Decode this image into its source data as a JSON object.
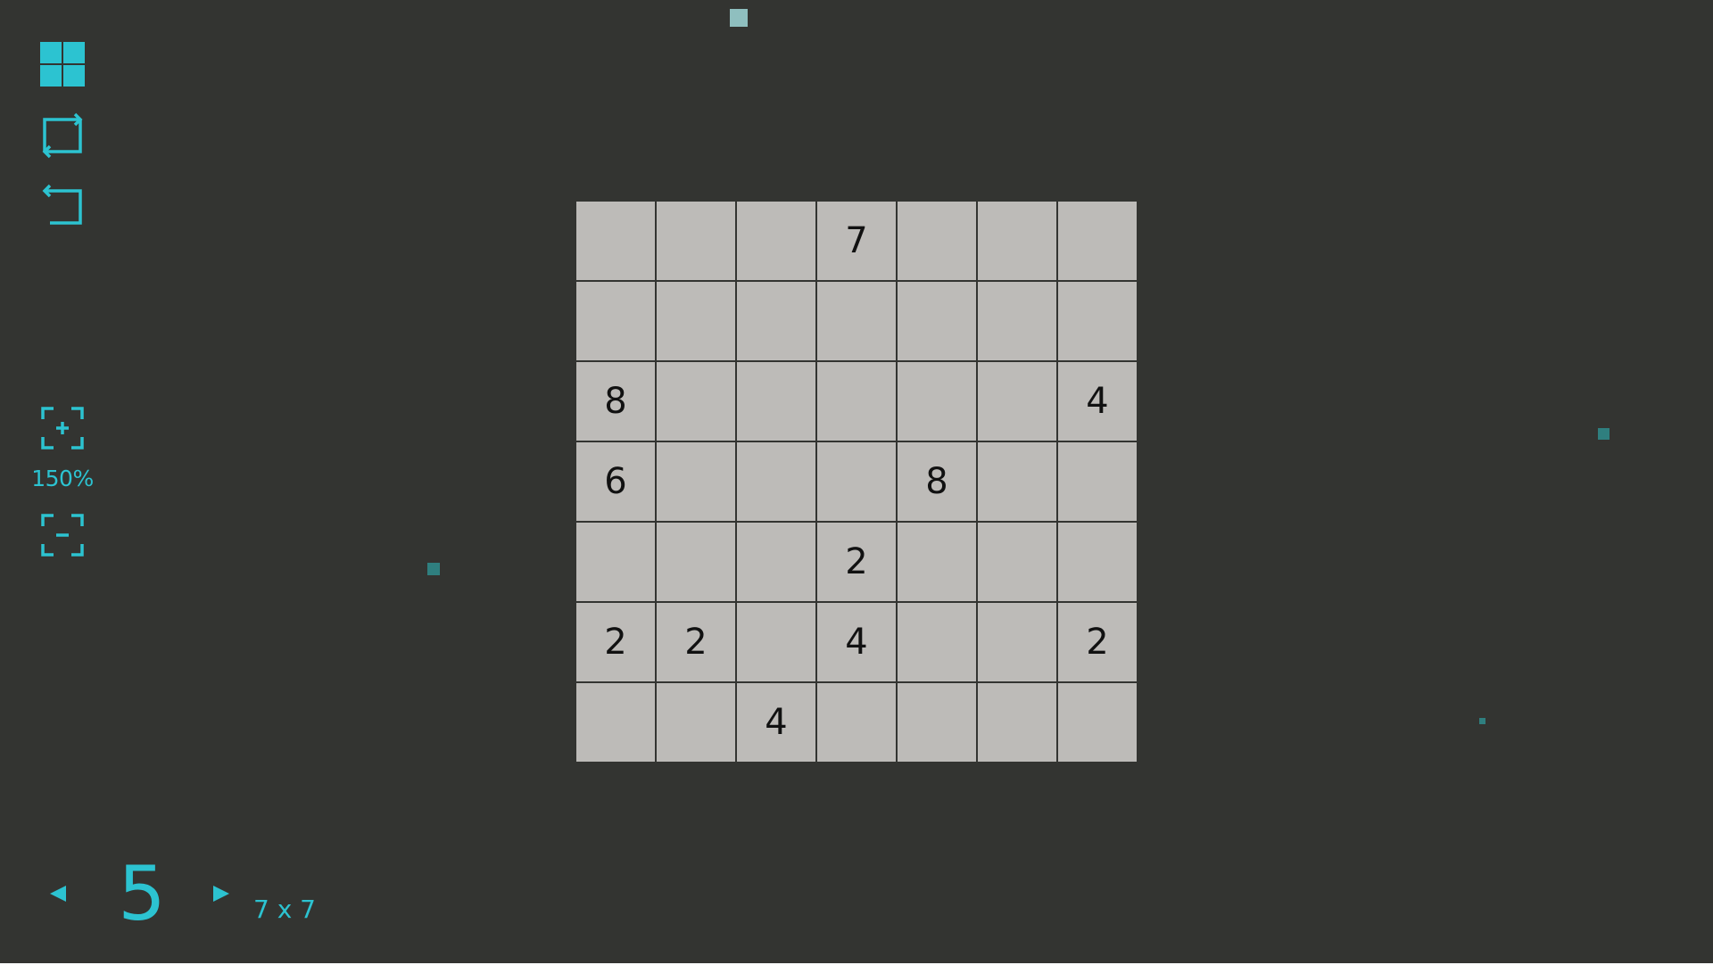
{
  "toolbar": {
    "icons": [
      "levels-grid-icon",
      "restart-icon",
      "undo-icon"
    ]
  },
  "zoom": {
    "level_label": "150%",
    "zoom_in_icon": "zoom-in-icon",
    "zoom_out_icon": "zoom-out-icon"
  },
  "puzzle": {
    "rows": 7,
    "cols": 7,
    "cells": [
      [
        "",
        "",
        "",
        "7",
        "",
        "",
        ""
      ],
      [
        "",
        "",
        "",
        "",
        "",
        "",
        ""
      ],
      [
        "8",
        "",
        "",
        "",
        "",
        "",
        "4"
      ],
      [
        "6",
        "",
        "",
        "",
        "8",
        "",
        ""
      ],
      [
        "",
        "",
        "",
        "2",
        "",
        "",
        ""
      ],
      [
        "2",
        "2",
        "",
        "4",
        "",
        "",
        "2"
      ],
      [
        "",
        "",
        "4",
        "",
        "",
        "",
        ""
      ]
    ]
  },
  "level_nav": {
    "level_number": "5",
    "grid_size_label": "7 x 7",
    "prev_icon": "triangle-left-icon",
    "next_icon": "triangle-right-icon"
  },
  "colors": {
    "background": "#333431",
    "accent": "#2cc3d1",
    "cell": "#bdbbb8",
    "cell_text": "#111111",
    "particle_light": "#8fbfbf",
    "particle_dark": "#2f7f7f"
  }
}
